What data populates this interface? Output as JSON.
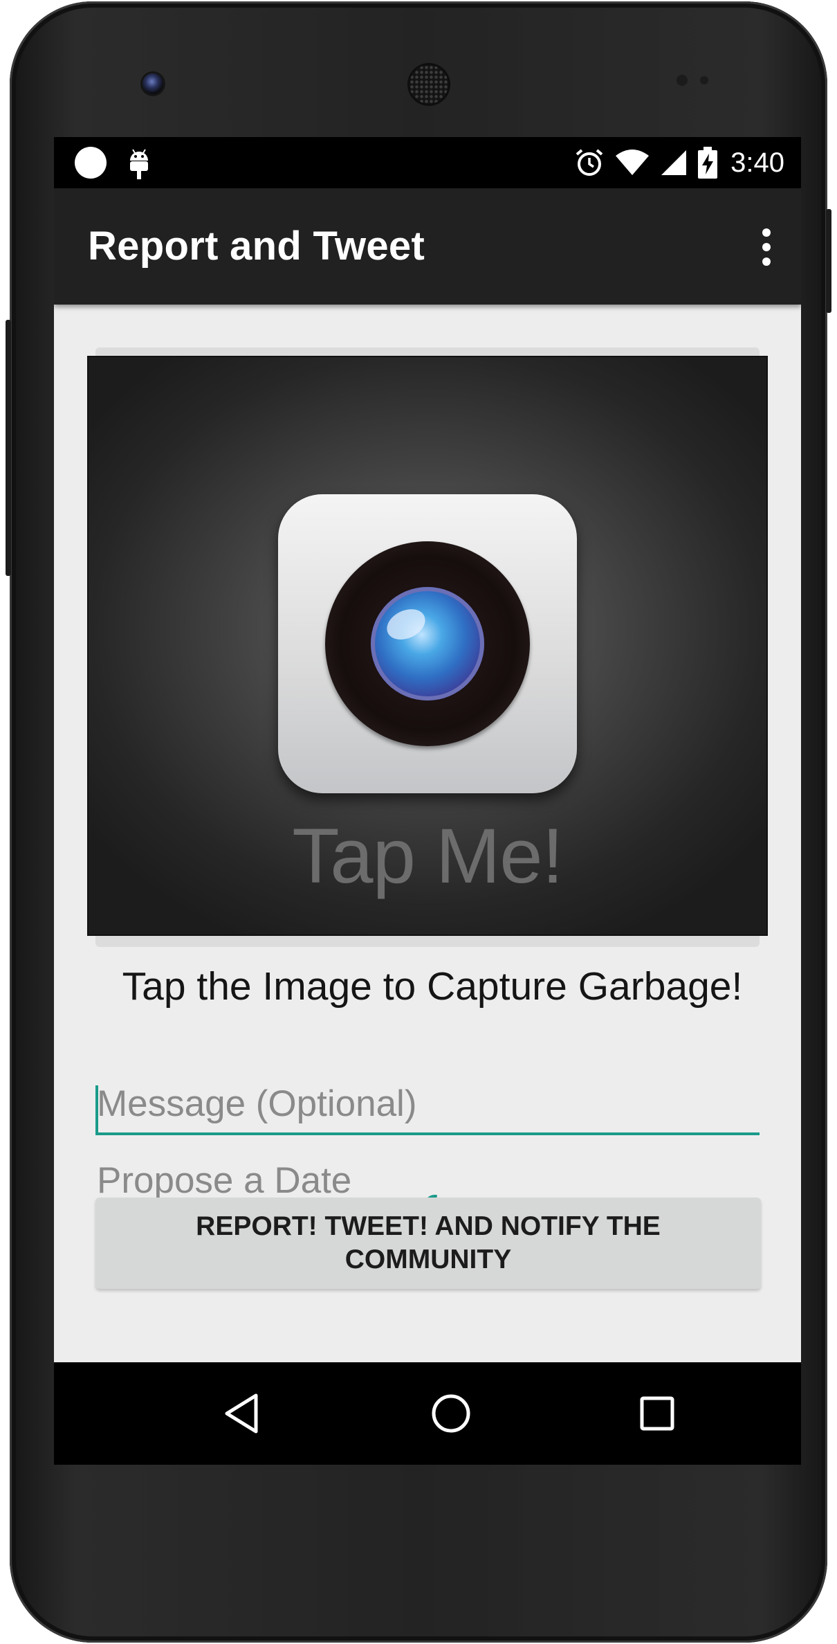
{
  "status_bar": {
    "time": "3:40",
    "icons": [
      "notification-dot-icon",
      "android-debug-icon",
      "alarm-icon",
      "wifi-icon",
      "cell-signal-icon",
      "battery-charging-icon"
    ]
  },
  "app_bar": {
    "title": "Report and Tweet",
    "menu_icon": "overflow-menu-icon"
  },
  "capture": {
    "image_text": "Tap Me!",
    "image_icon": "camera-icon",
    "instruction": "Tap the Image to Capture Garbage!"
  },
  "form": {
    "message_placeholder": "Message (Optional)",
    "date_placeholder": "Propose a Date",
    "submit_label": "REPORT! TWEET! AND NOTIFY THE COMMUNITY"
  },
  "nav_bar": {
    "icons": [
      "back-icon",
      "home-icon",
      "recents-icon"
    ]
  },
  "colors": {
    "accent": "#1a9a8a",
    "app_bar": "#212121",
    "background": "#ededed",
    "button": "#d6d7d7"
  }
}
